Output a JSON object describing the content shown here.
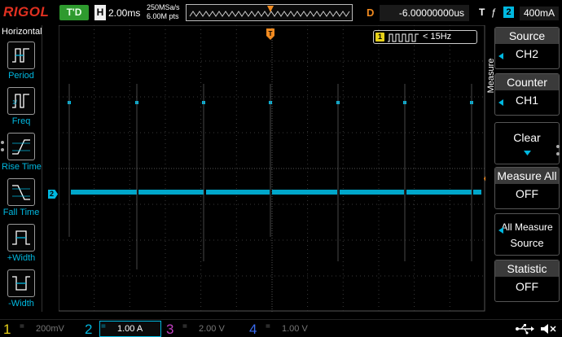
{
  "topbar": {
    "logo": "RIGOL",
    "run_status": "T'D",
    "timebase_letter": "H",
    "timebase": "2.00ms",
    "sample_rate": "250MSa/s",
    "memory_depth": "6.00M pts",
    "delay_letter": "D",
    "delay": "-6.00000000us",
    "trigger_letter": "T",
    "trigger_edge": "ƒ",
    "trigger_channel": "2",
    "trigger_level": "400mA"
  },
  "left_menu": {
    "title": "Horizontal",
    "items": [
      {
        "label": "Period",
        "icon": "period-icon"
      },
      {
        "label": "Freq",
        "icon": "freq-icon"
      },
      {
        "label": "Rise Time",
        "icon": "rise-time-icon"
      },
      {
        "label": "Fall Time",
        "icon": "fall-time-icon"
      },
      {
        "label": "+Width",
        "icon": "positive-width-icon"
      },
      {
        "label": "-Width",
        "icon": "negative-width-icon"
      }
    ]
  },
  "measurement": {
    "number": "1",
    "value": "< 15Hz"
  },
  "markers": {
    "channel2": "2",
    "trigger_level": "T"
  },
  "right_menu": {
    "title": "Measure",
    "items": [
      {
        "head": "Source",
        "value": "CH2"
      },
      {
        "head": "Counter",
        "value": "CH1"
      },
      {
        "single": "Clear"
      },
      {
        "head": "Measure All",
        "value": "OFF"
      },
      {
        "line1": "All Measure",
        "line2": "Source"
      },
      {
        "head": "Statistic",
        "value": "OFF"
      }
    ]
  },
  "channels": [
    {
      "num": "1",
      "coupling": "=",
      "scale": "200mV",
      "color": "#e8d21a"
    },
    {
      "num": "2",
      "coupling": "=",
      "scale": "1.00 A",
      "color": "#00b8e0"
    },
    {
      "num": "3",
      "coupling": "=",
      "scale": "2.00 V",
      "color": "#c040c0"
    },
    {
      "num": "4",
      "coupling": "=",
      "scale": "1.00 V",
      "color": "#3a6cf0"
    }
  ],
  "colors": {
    "ch1": "#e8d21a",
    "ch2": "#00b8e0",
    "ch3": "#c040c0",
    "ch4": "#3a6cf0",
    "trigger": "#f08a20",
    "run_status": "#2e9a2e"
  }
}
